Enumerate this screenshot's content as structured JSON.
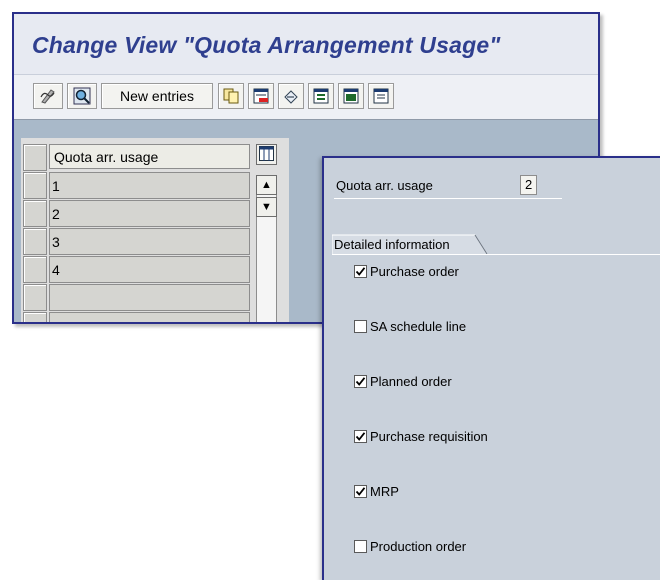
{
  "window": {
    "title": "Change View \"Quota Arrangement Usage\""
  },
  "toolbar": {
    "new_entries_label": "New entries",
    "icons": [
      "display-change-icon",
      "details-icon",
      "copy-icon",
      "delete-icon",
      "undo-change-icon",
      "select-all-icon",
      "select-block-icon",
      "deselect-all-icon"
    ]
  },
  "table": {
    "header": "Quota arr. usage",
    "rows": [
      "1",
      "2",
      "3",
      "4",
      ""
    ]
  },
  "detail": {
    "field_label": "Quota arr. usage",
    "field_value": "2",
    "group_title": "Detailed information",
    "options": [
      {
        "label": "Purchase order",
        "checked": true
      },
      {
        "label": "SA schedule line",
        "checked": false
      },
      {
        "label": "Planned order",
        "checked": true
      },
      {
        "label": "Purchase requisition",
        "checked": true
      },
      {
        "label": "MRP",
        "checked": true
      },
      {
        "label": "Production order",
        "checked": false
      }
    ]
  },
  "colors": {
    "title": "#2f3f8f",
    "window_border": "#2a2f8a",
    "background": "#a9b9c9"
  }
}
